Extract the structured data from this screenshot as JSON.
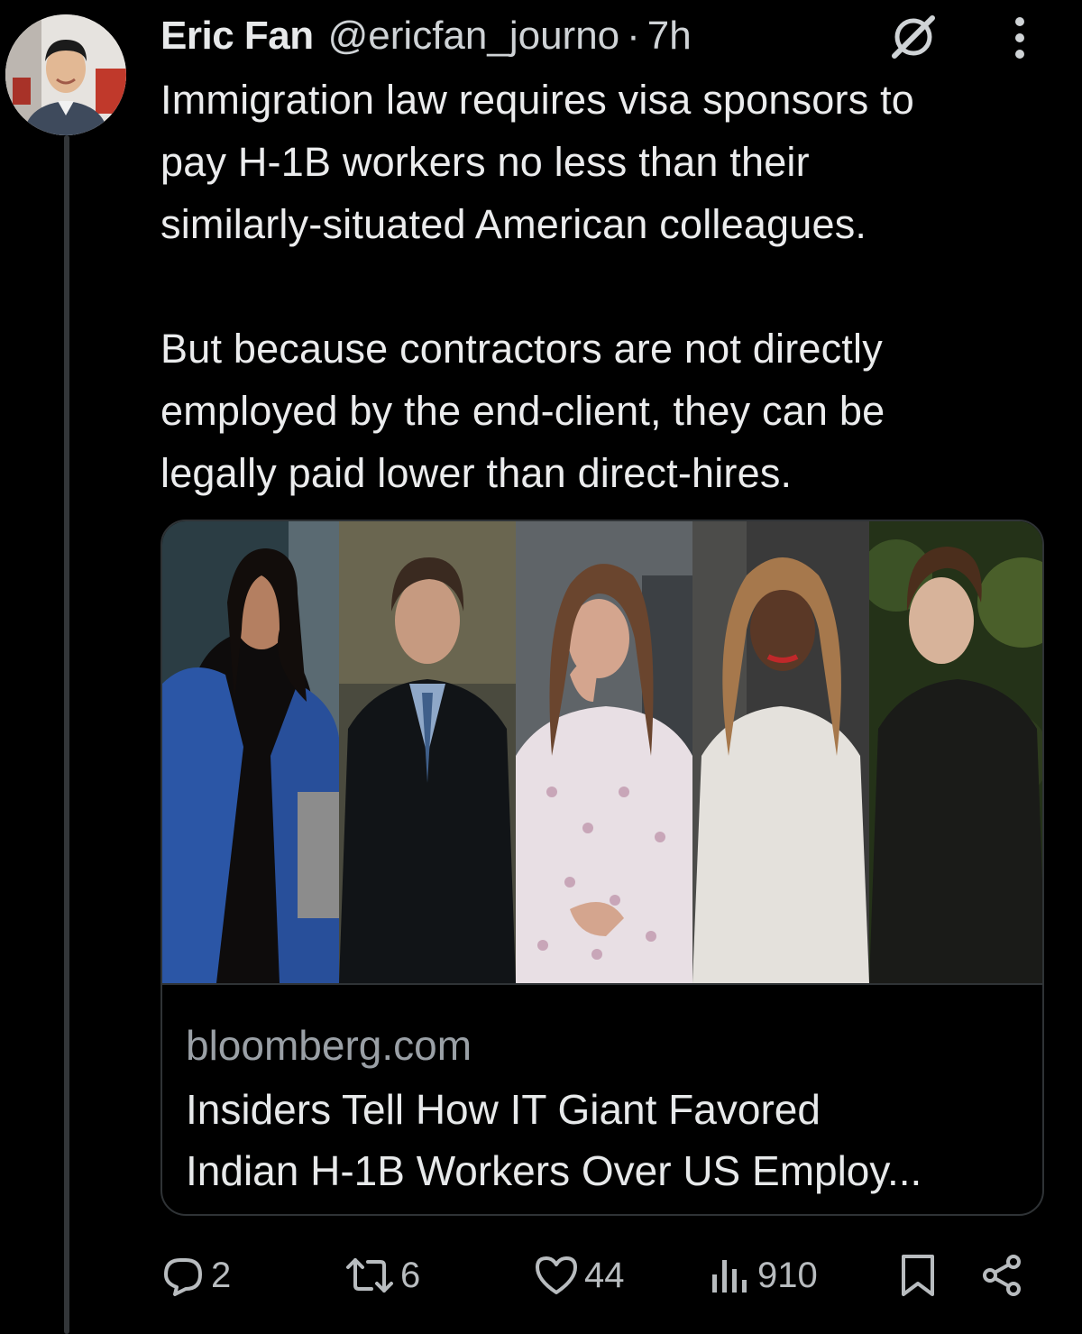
{
  "tweet": {
    "author_name": "Eric Fan",
    "author_handle": "@ericfan_journo",
    "separator": "·",
    "time": "7h",
    "text": "Immigration law requires visa sponsors to\npay H-1B workers no less than their\nsimilarly-situated American colleagues.\n\nBut because contractors are not directly\nemployed by the end-client, they can be\nlegally paid lower than  direct-hires."
  },
  "card": {
    "domain": "bloomberg.com",
    "title": "Insiders Tell How IT Giant Favored\nIndian H-1B Workers Over US Employ..."
  },
  "actions": {
    "replies": "2",
    "reposts": "6",
    "likes": "44",
    "views": "910"
  },
  "icons": {
    "grok": "grok-icon",
    "more": "more-options-icon",
    "reply": "reply-icon",
    "repost": "repost-icon",
    "like": "heart-icon",
    "views": "views-chart-icon",
    "bookmark": "bookmark-icon",
    "share": "share-icon"
  },
  "colors": {
    "background": "#000000",
    "text": "#e7e9ea",
    "secondary": "#9aa0a6",
    "border": "#2f3336"
  }
}
